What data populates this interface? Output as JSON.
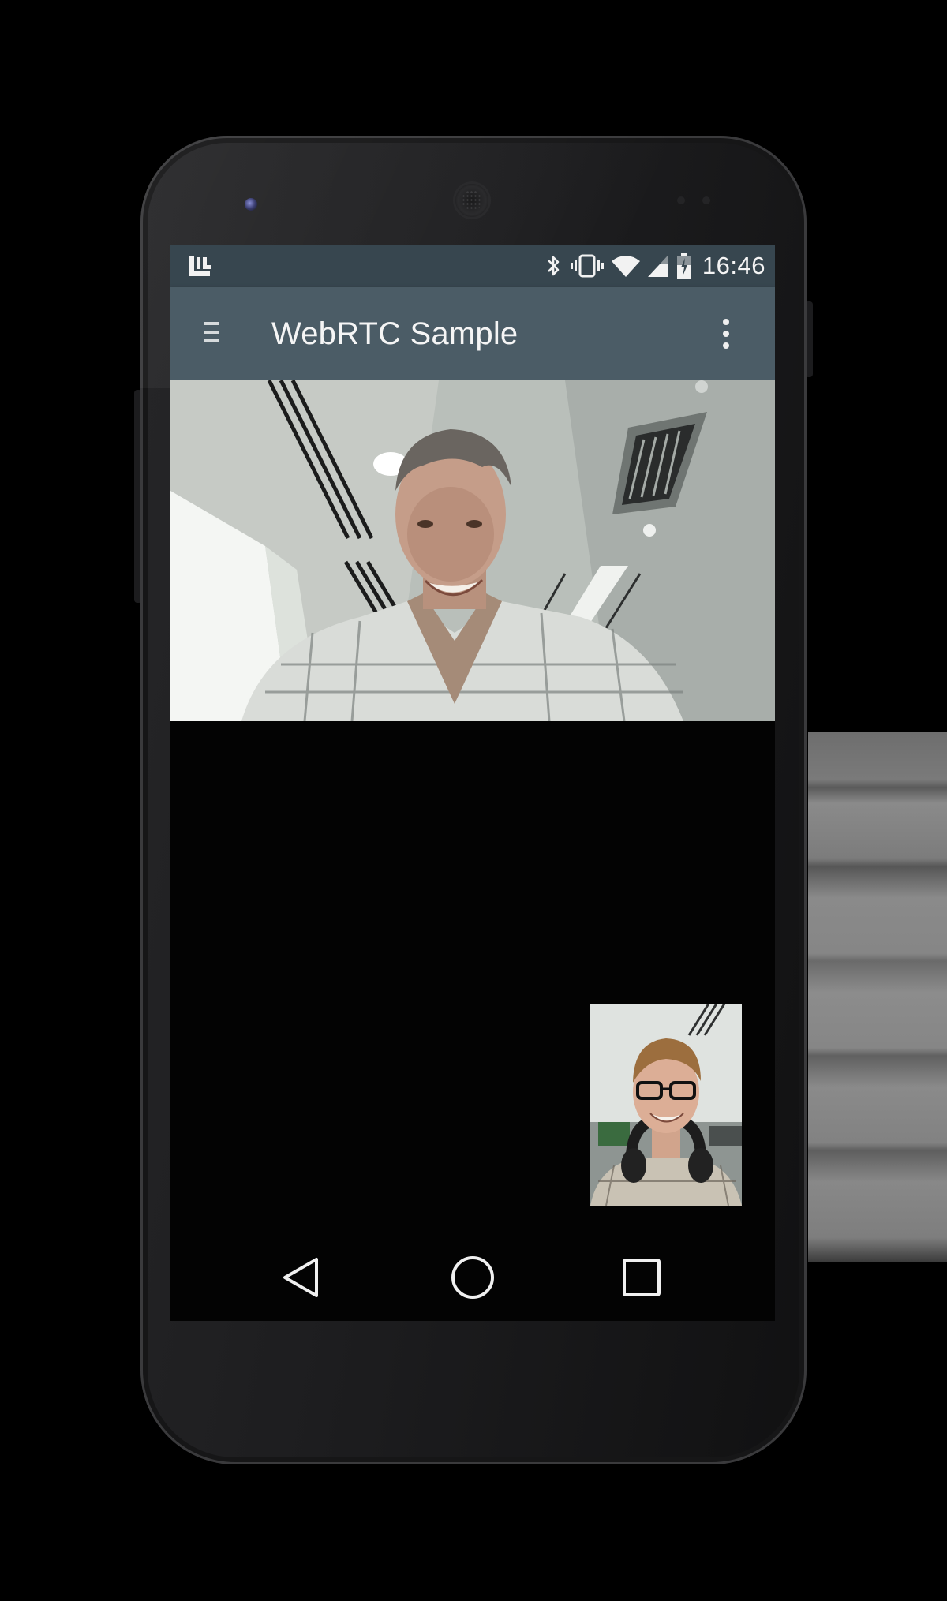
{
  "status_bar": {
    "time": "16:46",
    "icons": [
      "launcher-icon",
      "bluetooth-icon",
      "vibrate-icon",
      "wifi-icon",
      "cell-signal-icon",
      "battery-icon"
    ]
  },
  "app_bar": {
    "title": "WebRTC Sample",
    "menu_icon": "menu-icon",
    "overflow_icon": "more-vert-icon"
  },
  "nav_bar": {
    "buttons": [
      "back-icon",
      "home-icon",
      "recents-icon"
    ]
  },
  "colors": {
    "status_bar": "#37464f",
    "app_bar": "#4b5c66",
    "screen_background": "#030303"
  }
}
